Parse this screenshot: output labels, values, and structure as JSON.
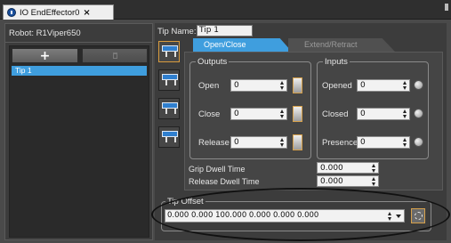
{
  "tab": {
    "title": "IO EndEffector0",
    "close": "×"
  },
  "left": {
    "robot_label": "Robot:  R1Viper650",
    "add_label": "+",
    "items": [
      "Tip 1"
    ]
  },
  "right": {
    "tip_name_label": "Tip Name:",
    "tip_name_value": "Tip 1",
    "tabs": [
      "Open/Close",
      "Extend/Retract"
    ],
    "outputs": {
      "title": "Outputs",
      "rows": [
        {
          "label": "Open",
          "value": "0"
        },
        {
          "label": "Close",
          "value": "0"
        },
        {
          "label": "Release",
          "value": "0"
        }
      ]
    },
    "inputs": {
      "title": "Inputs",
      "rows": [
        {
          "label": "Opened",
          "value": "0"
        },
        {
          "label": "Closed",
          "value": "0"
        },
        {
          "label": "Presence",
          "value": "0"
        }
      ]
    },
    "grip_dwell_label": "Grip Dwell Time",
    "grip_dwell_value": "0.000",
    "release_dwell_label": "Release Dwell Time",
    "release_dwell_value": "0.000",
    "tip_offset": {
      "title": "Tip Offset",
      "value": "0.000 0.000 100.000 0.000 0.000 0.000"
    }
  },
  "colors": {
    "accent": "#3f9ede",
    "highlight": "#d7a14b",
    "panel": "#3c3c3c"
  }
}
